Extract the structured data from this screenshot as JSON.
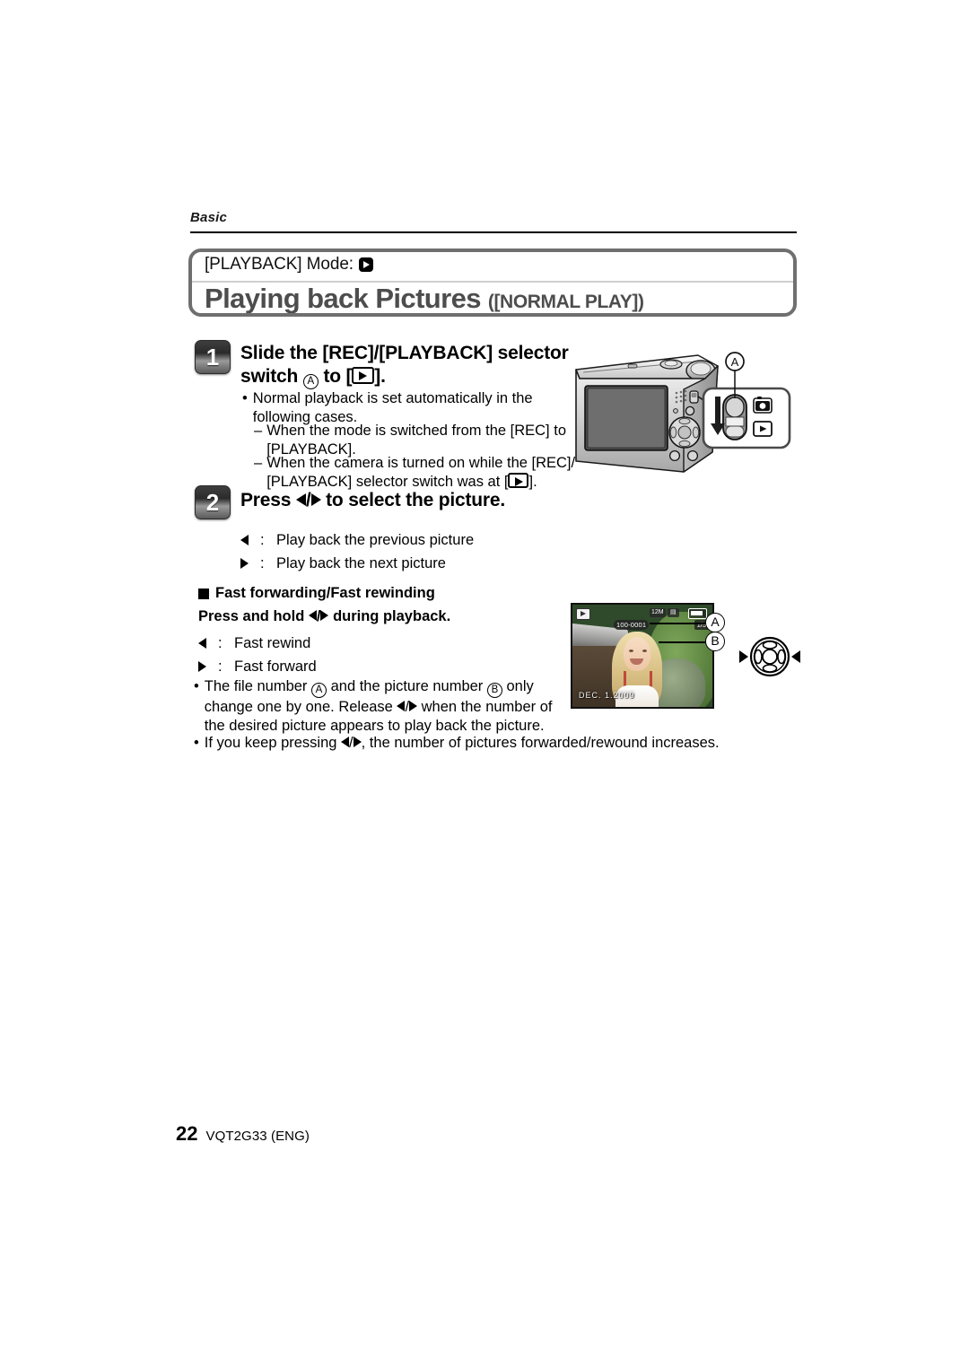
{
  "page": {
    "running_head": "Basic",
    "footer_page_number": "22",
    "footer_doc_id": "VQT2G33 (ENG)"
  },
  "title_block": {
    "mode_label": "[PLAYBACK] Mode:",
    "mode_icon": "playback-icon",
    "heading_main": "Playing back Pictures",
    "heading_suffix": "([NORMAL PLAY])"
  },
  "steps": [
    {
      "number": "1",
      "heading_line1": "Slide the [REC]/[PLAYBACK] selector",
      "heading_line2_pre": "switch",
      "heading_line2_ref": "A",
      "heading_line2_mid": "to [",
      "heading_line2_post": "].",
      "bullets": [
        {
          "marker": "•",
          "line1": "Normal playback is set automatically in the",
          "line2": "following cases."
        }
      ],
      "dashes": [
        {
          "marker": "–",
          "line1": "When the mode is switched from the [REC] to",
          "line2": "[PLAYBACK]."
        },
        {
          "marker": "–",
          "line1": "When the camera is turned on while the [REC]/",
          "line2_pre": "[PLAYBACK] selector switch was at [",
          "line2_post": "]."
        }
      ]
    },
    {
      "number": "2",
      "heading_pre": "Press",
      "heading_arrow_left": "◀",
      "heading_slash": "/",
      "heading_arrow_right": "▶",
      "heading_post": "to select the picture.",
      "key_list": [
        {
          "key": "left-arrow",
          "sep": ":",
          "text": "Play back the previous picture"
        },
        {
          "key": "right-arrow",
          "sep": ":",
          "text": "Play back the next picture"
        }
      ]
    }
  ],
  "subsection": {
    "square_bullet": "■",
    "heading": "Fast forwarding/Fast rewinding",
    "instruction_pre": "Press and hold",
    "instruction_post": "during playback.",
    "key_list": [
      {
        "key": "left-arrow",
        "sep": ":",
        "text": "Fast rewind"
      },
      {
        "key": "right-arrow",
        "sep": ":",
        "text": "Fast forward"
      }
    ],
    "notes": [
      {
        "marker": "•",
        "seg1": "The file number",
        "ref1": "A",
        "seg2": "and the picture number",
        "ref2": "B",
        "seg3": "only",
        "line2_pre": "change one by one. Release",
        "line2_post": "when the number of",
        "line3": "the desired picture appears to play back the picture."
      },
      {
        "marker": "•",
        "line1_pre": "If you keep pressing",
        "line1_post": ", the number of pictures forwarded/rewound increases."
      }
    ]
  },
  "camera_figure": {
    "name": "camera-rear-illustration",
    "callout_label": "A",
    "selector_top_icon": "record-camera-icon",
    "selector_bottom_icon": "playback-icon",
    "slide_direction": "down"
  },
  "lcd_figure": {
    "name": "lcd-playback-screenshot",
    "overlay": {
      "playback_mode_icon": "playback-icon",
      "resolution": "12M",
      "quality_icon": "fine-quality-icon",
      "battery_icon": "battery-full-icon",
      "file_number": "100-0001",
      "picture_number": "1/5",
      "date_stamp": "DEC. 1.2009"
    },
    "callouts": [
      {
        "label": "A",
        "points_to": "file-number"
      },
      {
        "label": "B",
        "points_to": "picture-number"
      }
    ]
  },
  "dpad_figure": {
    "name": "cursor-button-illustration",
    "left_arrow": "◀",
    "right_arrow": "▶"
  }
}
